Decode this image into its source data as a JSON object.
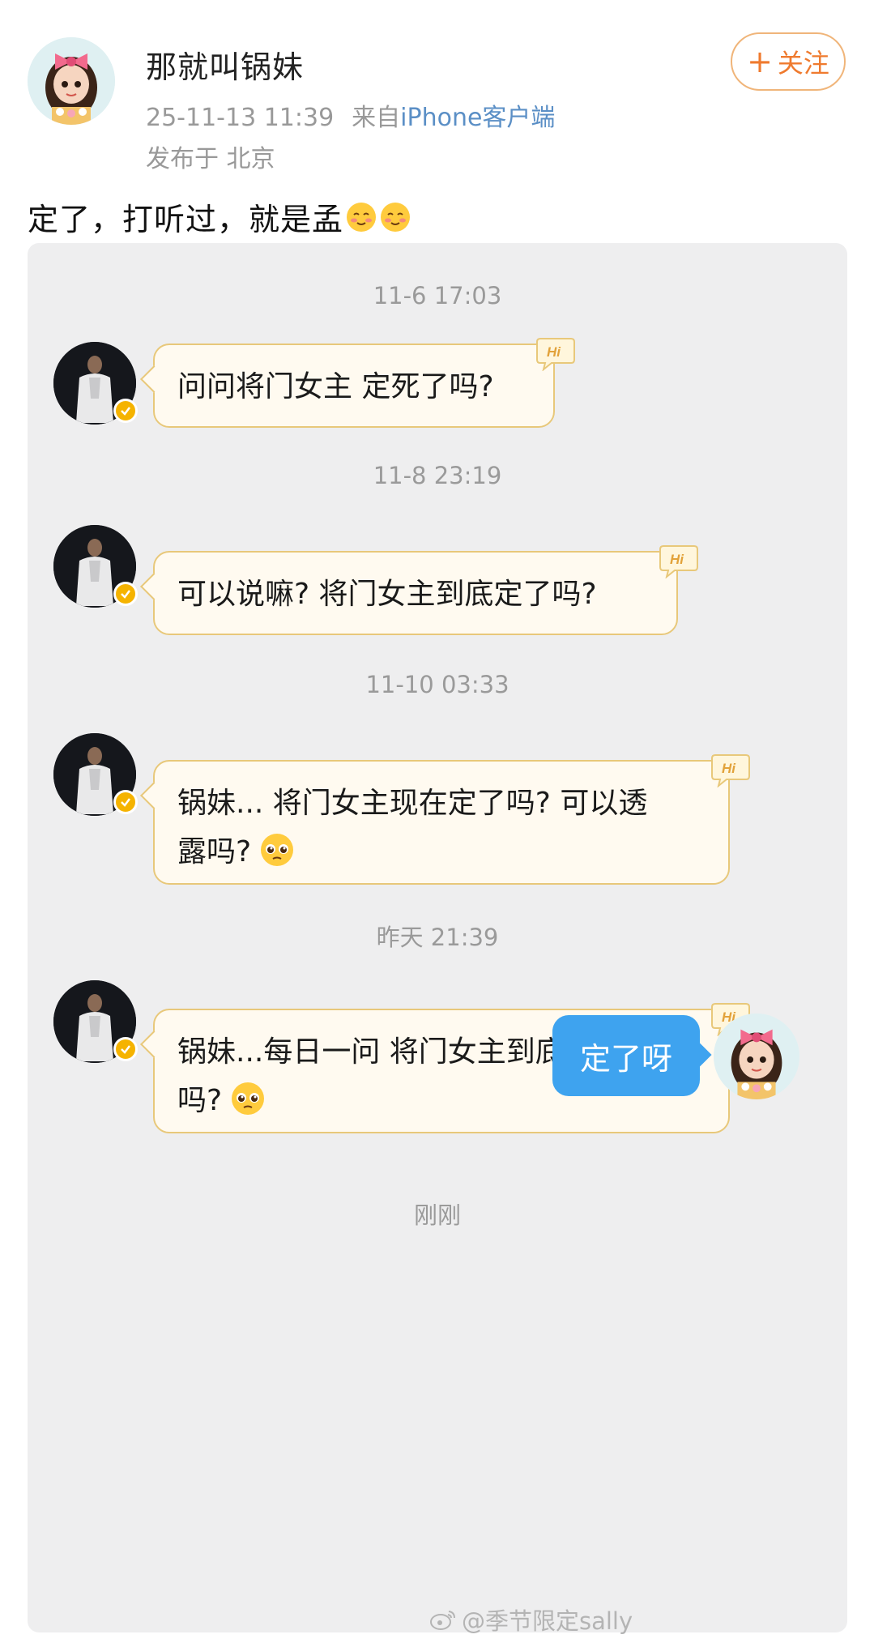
{
  "post": {
    "username": "那就叫锅妹",
    "datetime": "25-11-13 11:39",
    "source_prefix": "来自",
    "source_client": "iPhone客户端",
    "location": "发布于 北京",
    "follow_plus": "+",
    "follow_label": "关注",
    "text": "定了，打听过，就是孟"
  },
  "chat": {
    "messages": [
      {
        "time": "11-6 17:03",
        "text": "问问将门女主 定死了吗?"
      },
      {
        "time": "11-8 23:19",
        "text": "可以说嘛? 将门女主到底定了吗?"
      },
      {
        "time": "11-10 03:33",
        "line1": "锅妹... 将门女主现在定了吗? 可以透",
        "line2": "露吗?"
      },
      {
        "time": "昨天 21:39",
        "line1": "锅妹...每日一问 将门女主到底定了",
        "line2": "吗?"
      }
    ],
    "reply_time": "刚刚",
    "reply_text": "定了呀",
    "hi_label": "Hi"
  },
  "watermark": {
    "text": "@季节限定sally"
  },
  "colors": {
    "accent_orange": "#ef7a2e",
    "bubble_in_bg": "#fffaf0",
    "bubble_in_border": "#e8c87a",
    "bubble_out_bg": "#3ea3ef",
    "chat_bg": "#eeeeef"
  },
  "icons": [
    "girl-avatar-icon",
    "black-figure-avatar-icon",
    "verified-badge-icon",
    "hi-sticker-icon",
    "blushing-emoji-icon",
    "pleading-emoji-icon",
    "weibo-logo-icon"
  ]
}
